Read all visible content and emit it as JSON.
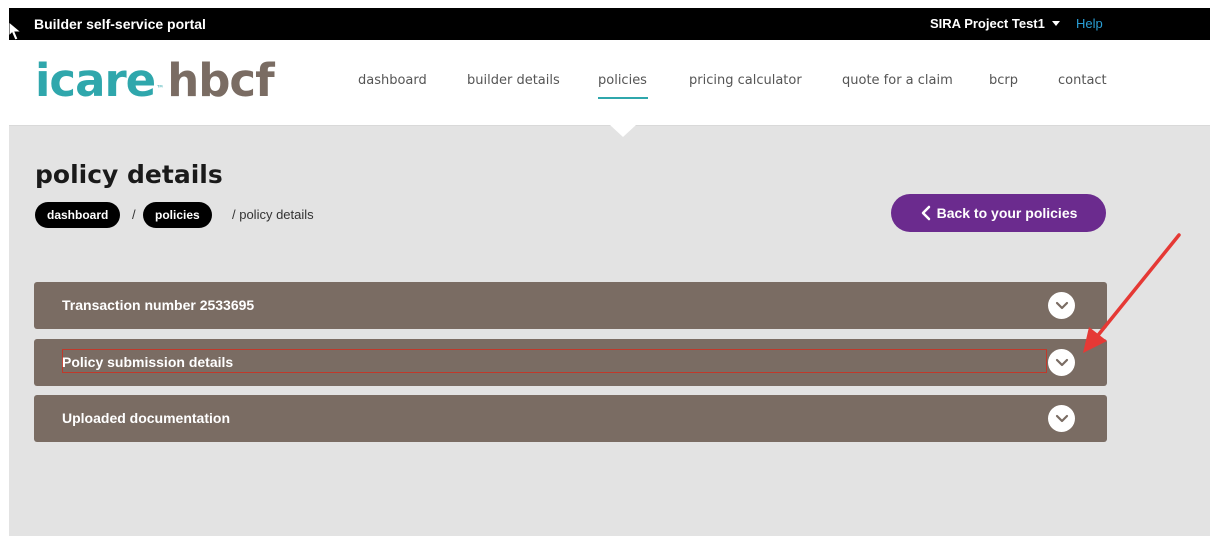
{
  "topbar": {
    "brand": "Builder self-service portal",
    "user": "SIRA Project Test1",
    "help": "Help"
  },
  "logo": {
    "part1": "icare",
    "tm": "™",
    "part2": "hbcf"
  },
  "nav": {
    "items": [
      "dashboard",
      "builder details",
      "policies",
      "pricing calculator",
      "quote for a claim",
      "bcrp",
      "contact"
    ],
    "active": "policies"
  },
  "page": {
    "title": "policy details",
    "breadcrumb": {
      "crumb1": "dashboard",
      "sep1": "/",
      "crumb2": "policies",
      "current": "/ policy details"
    },
    "back_button": "Back to your policies"
  },
  "accordions": [
    {
      "title": "Transaction number 2533695"
    },
    {
      "title": "Policy submission details"
    },
    {
      "title": "Uploaded documentation"
    }
  ],
  "colors": {
    "accent_teal": "#2fa7ac",
    "accordion_bg": "#7a6c63",
    "back_button_bg": "#6b2b8e",
    "annotation_red": "#e53935"
  },
  "icons": {
    "accordion_toggle": "chevron-down-icon",
    "back": "chevron-left-icon",
    "user_menu": "caret-down-icon"
  }
}
